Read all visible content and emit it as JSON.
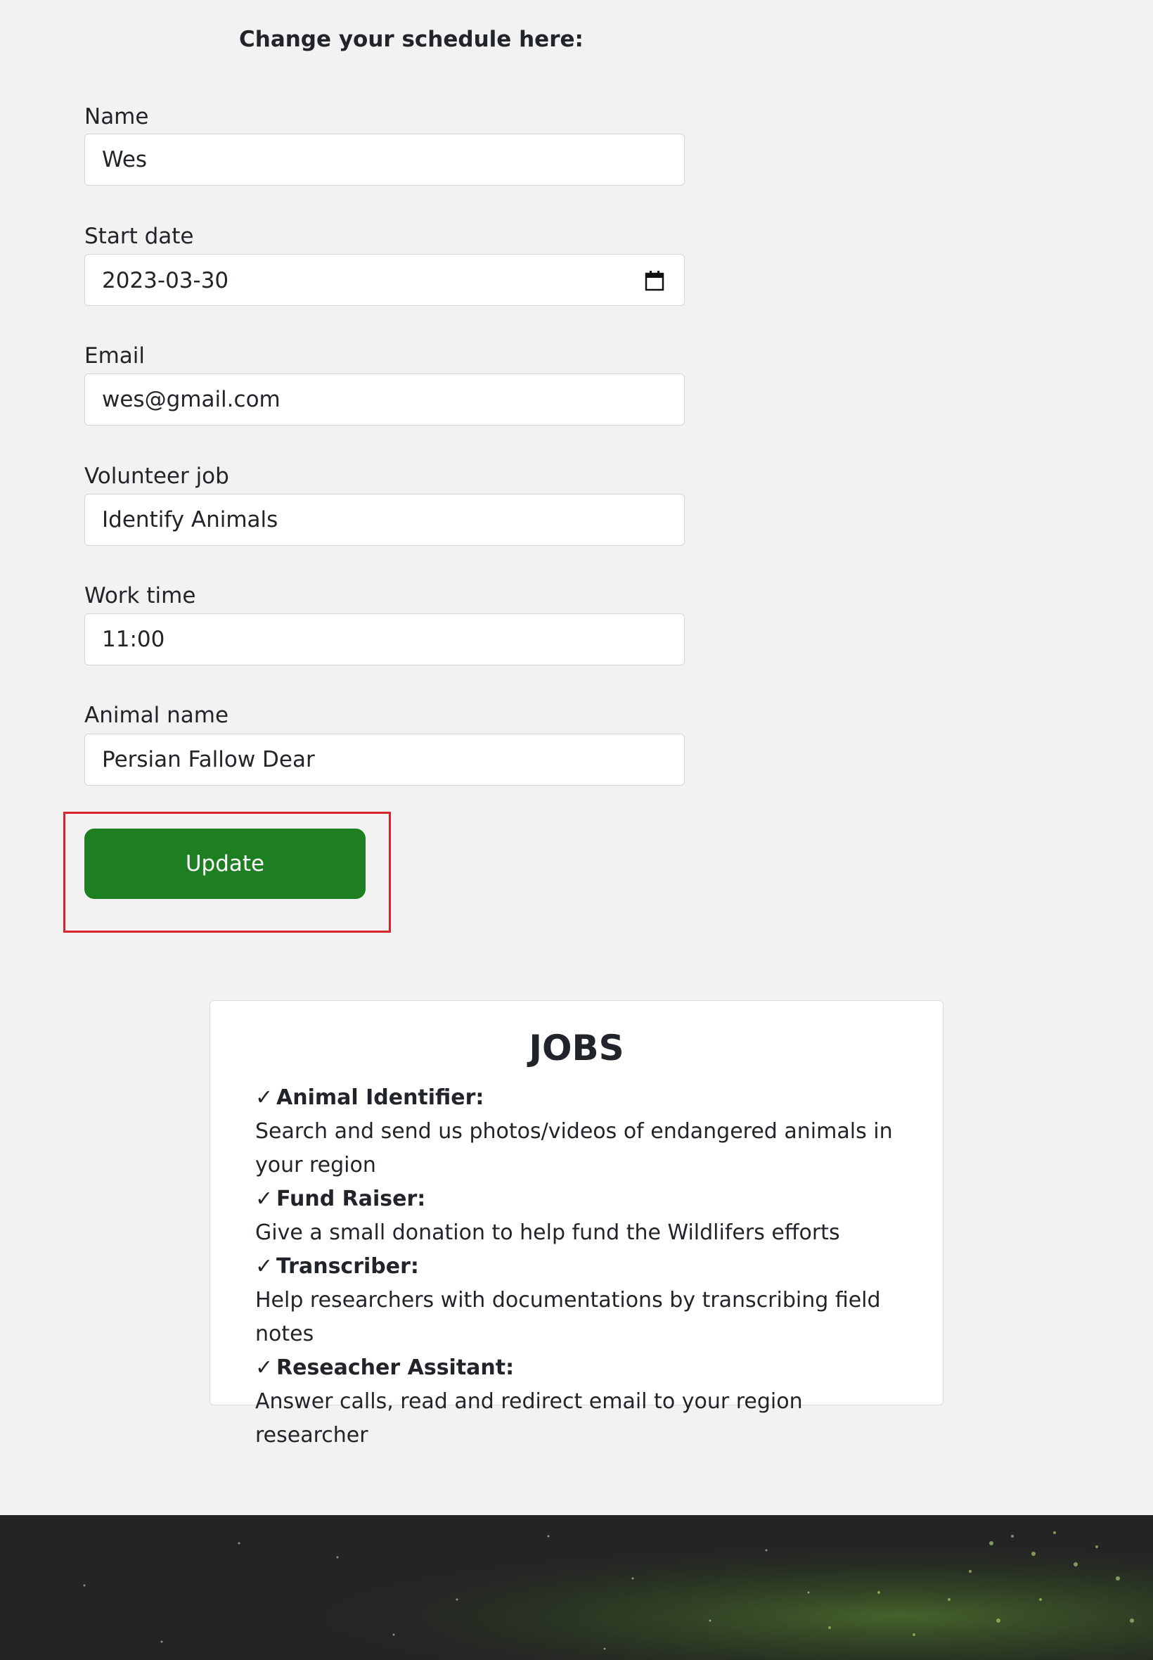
{
  "form": {
    "heading": "Change your schedule here:",
    "fields": {
      "name": {
        "label": "Name",
        "value": "Wes"
      },
      "start_date": {
        "label": "Start date",
        "value": "2023-03-30"
      },
      "email": {
        "label": "Email",
        "value": "wes@gmail.com"
      },
      "volunteer_job": {
        "label": "Volunteer job",
        "value": "Identify Animals"
      },
      "work_time": {
        "label": "Work time",
        "value": "11:00"
      },
      "animal_name": {
        "label": "Animal name",
        "value": "Persian Fallow Dear"
      }
    },
    "update_label": "Update"
  },
  "jobs": {
    "title": "JOBS",
    "items": [
      {
        "title": "Animal Identifier:",
        "description": "Search and send us photos/videos of endangered animals in your region"
      },
      {
        "title": "Fund Raiser:",
        "description": "Give a small donation to help fund the Wildlifers efforts"
      },
      {
        "title": "Transcriber:",
        "description": "Help researchers with documentations by transcribing field notes"
      },
      {
        "title": "Reseacher Assitant:",
        "description": "Answer calls, read and redirect email to your region researcher"
      }
    ]
  },
  "colors": {
    "background": "#f2f2f2",
    "button": "#1e7e22",
    "highlight": "#d9232e"
  },
  "icons": {
    "check": "check-icon",
    "calendar": "calendar-icon"
  }
}
